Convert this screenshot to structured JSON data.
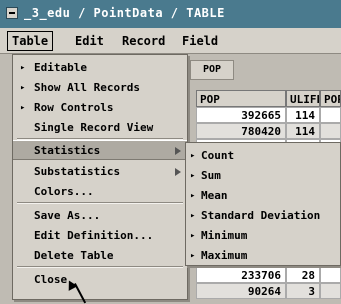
{
  "window": {
    "title": "_3_edu / PointData / TABLE"
  },
  "menubar": {
    "items": [
      "Table",
      "Edit",
      "Record",
      "Field"
    ]
  },
  "table": {
    "popup_label": "POP",
    "headers": [
      "POP",
      "ULIFE",
      "POP"
    ],
    "rows": [
      {
        "pop": "392665",
        "ulife": "114"
      },
      {
        "pop": "780420",
        "ulife": "114"
      },
      {
        "pop": "",
        "ulife": ""
      },
      {
        "pop": "",
        "ulife": ""
      },
      {
        "pop": "",
        "ulife": ""
      },
      {
        "pop": "",
        "ulife": ""
      },
      {
        "pop": "",
        "ulife": ""
      },
      {
        "pop": "",
        "ulife": ""
      },
      {
        "pop": "",
        "ulife": ""
      },
      {
        "pop": "",
        "ulife": ""
      },
      {
        "pop": "233706",
        "ulife": "28"
      },
      {
        "pop": "90264",
        "ulife": "3"
      }
    ]
  },
  "table_menu": {
    "items": [
      {
        "label": "Editable",
        "mark": "▸"
      },
      {
        "label": "Show All Records",
        "mark": "▸"
      },
      {
        "label": "Row Controls",
        "mark": "▸"
      },
      {
        "label": "Single Record View",
        "mark": ""
      },
      {
        "label": "Statistics",
        "mark": "",
        "submenu": true
      },
      {
        "label": "Substatistics",
        "mark": "",
        "submenu": true
      },
      {
        "label": "Colors...",
        "mark": ""
      },
      {
        "label": "Save As...",
        "mark": ""
      },
      {
        "label": "Edit Definition...",
        "mark": ""
      },
      {
        "label": "Delete Table",
        "mark": ""
      },
      {
        "label": "Close",
        "mark": ""
      }
    ]
  },
  "statistics_submenu": {
    "items": [
      {
        "label": "Count",
        "mark": "▸"
      },
      {
        "label": "Sum",
        "mark": "▸"
      },
      {
        "label": "Mean",
        "mark": "▸"
      },
      {
        "label": "Standard Deviation",
        "mark": "▸"
      },
      {
        "label": "Minimum",
        "mark": "▸"
      },
      {
        "label": "Maximum",
        "mark": "▸"
      }
    ]
  },
  "colors": {
    "titlebar": "#4a7a8e",
    "menu": "#d6d2ca",
    "highlight": "#aeaaa2"
  }
}
